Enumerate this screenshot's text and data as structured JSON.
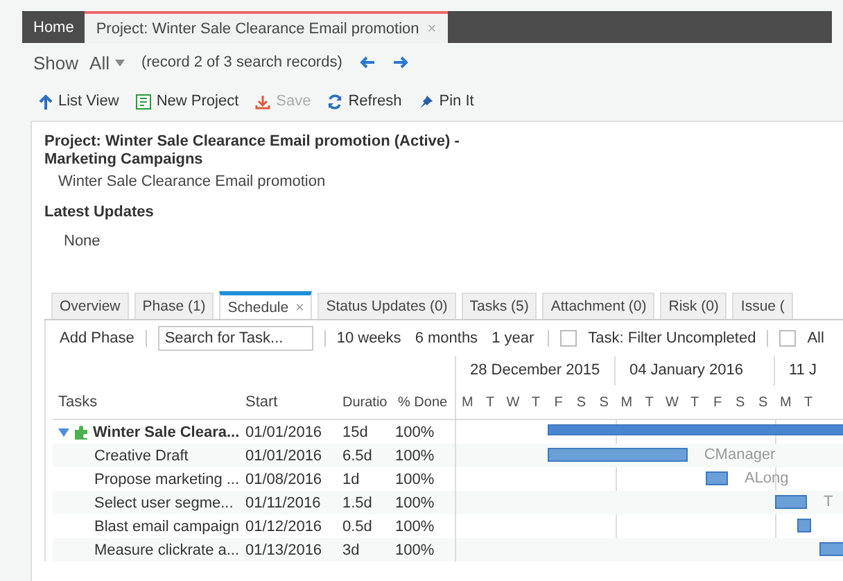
{
  "top_tabs": [
    {
      "label": "Home",
      "selected": false
    },
    {
      "label": "Project: Winter Sale Clearance Email promotion",
      "selected": true,
      "close": "×"
    }
  ],
  "record_bar": {
    "show_label": "Show",
    "filter": "All",
    "record": "(record 2 of 3 search records)"
  },
  "toolbar": [
    {
      "kind": "list",
      "label": "List View",
      "disabled": false
    },
    {
      "kind": "new",
      "label": "New Project",
      "disabled": false
    },
    {
      "kind": "save",
      "label": "Save",
      "disabled": true
    },
    {
      "kind": "refresh",
      "label": "Refresh",
      "disabled": false
    },
    {
      "kind": "pin",
      "label": "Pin It",
      "disabled": false
    }
  ],
  "details": {
    "title": "Project: Winter Sale Clearance Email promotion (Active) -",
    "subtitle": "Marketing Campaigns",
    "description": "Winter Sale Clearance Email promotion",
    "updates_heading": "Latest Updates",
    "updates": "None"
  },
  "tabs": [
    {
      "label": "Overview",
      "selected": false
    },
    {
      "label": "Phase (1)",
      "selected": false
    },
    {
      "label": "Schedule",
      "selected": true,
      "close": "×"
    },
    {
      "label": "Status Updates (0)",
      "selected": false
    },
    {
      "label": "Tasks (5)",
      "selected": false
    },
    {
      "label": "Attachment (0)",
      "selected": false
    },
    {
      "label": "Risk (0)",
      "selected": false
    },
    {
      "label": "Issue (",
      "selected": false
    }
  ],
  "schedule_toolbar": {
    "add": "Add Phase",
    "search": {
      "placeholder": "Search for Task..."
    },
    "ranges": [
      "10 weeks",
      "6 months",
      "1 year"
    ],
    "filters": [
      {
        "label": "Task: Filter Uncompleted",
        "checked": false
      },
      {
        "label": "All",
        "checked": false
      }
    ]
  },
  "gantt": {
    "columns": [
      "Tasks",
      "Start",
      "Duratio",
      "% Done"
    ],
    "weeks": [
      "28 December 2015",
      "04 January 2016",
      "11 J"
    ],
    "days": [
      "M",
      "T",
      "W",
      "T",
      "F",
      "S",
      "S",
      "M",
      "T",
      "W",
      "T",
      "F",
      "S",
      "S",
      "M",
      "T"
    ],
    "rows": [
      {
        "name": "Winter Sale Cleara...",
        "start": "01/01/2016",
        "duration": "15d",
        "done": "100%",
        "kind": "summary",
        "expanded": true,
        "children": [
          {
            "name": "Creative Draft",
            "start": "01/01/2016",
            "duration": "6.5d",
            "done": "100%",
            "kind": "task",
            "resource": "CManager"
          },
          {
            "name": "Propose marketing ...",
            "start": "01/08/2016",
            "duration": "1d",
            "done": "100%",
            "kind": "task",
            "resource": "ALong"
          },
          {
            "name": "Select user segme...",
            "start": "01/11/2016",
            "duration": "1.5d",
            "done": "100%",
            "kind": "task",
            "resource": "T"
          },
          {
            "name": "Blast email campaign",
            "start": "01/12/2016",
            "duration": "0.5d",
            "done": "100%",
            "kind": "task"
          },
          {
            "name": "Measure clickrate a...",
            "start": "01/13/2016",
            "duration": "3d",
            "done": "100%",
            "kind": "task"
          }
        ]
      }
    ]
  }
}
